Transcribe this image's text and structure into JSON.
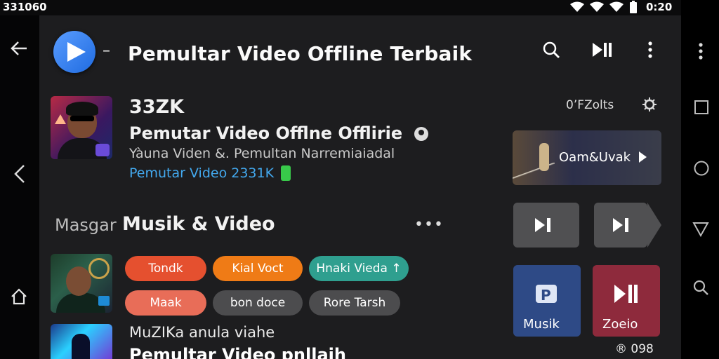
{
  "status_bar": {
    "left_text": "331060",
    "clock": "0:20"
  },
  "app_bar": {
    "dash": "–",
    "title": "Pemultar Video Offline Terbaik"
  },
  "header_item": {
    "name": "33ZK",
    "title": "Pemutar Video Offlne Offlirie",
    "subtitle": "Yàuna Viden &. Pemultan Narremiaiadal",
    "meta": "Pemutar Video 2331K"
  },
  "right_panel": {
    "label": "0’FZolts",
    "banner_text": "Oam&Uvak"
  },
  "section": {
    "prefix": "Masgar",
    "title": "Musik & Video",
    "more": "•••"
  },
  "chips": [
    {
      "label": "Tondk",
      "color": "#e5502f"
    },
    {
      "label": "Kial Voct",
      "color": "#ef7b16"
    },
    {
      "label": "Hnaki Vieda ↑",
      "color": "#2f9f8f"
    },
    {
      "label": "Maak",
      "color": "#e86d58"
    },
    {
      "label": "bon doce",
      "color": "#4c4c4e"
    },
    {
      "label": "Rore Tarsh",
      "color": "#4c4c4e"
    }
  ],
  "tiles": [
    {
      "label": "Musik",
      "color": "#2e4a86"
    },
    {
      "label": "Zoeio",
      "color": "#8e2a3c"
    }
  ],
  "bottom_item": {
    "title": "MuZIKa anula viahe",
    "title2": "Pemultar Video pnllaih"
  },
  "bottom_count": "® 098"
}
